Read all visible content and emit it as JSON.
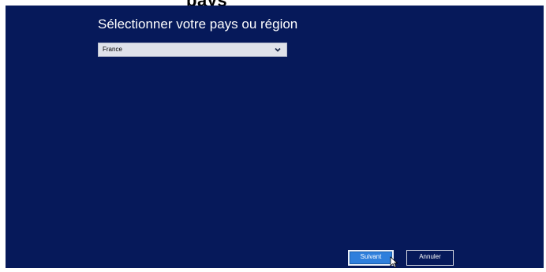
{
  "top_fragment": "pays",
  "setup": {
    "heading": "Sélectionner votre pays ou région",
    "country_select": {
      "selected": "France"
    },
    "buttons": {
      "next": "Suivant",
      "cancel": "Annuler"
    }
  },
  "colors": {
    "panel_background": "#06195a",
    "primary_button": "#2f7fdc"
  },
  "icons": {
    "dropdown": "chevron-down-icon",
    "pointer": "mouse-cursor-icon"
  }
}
